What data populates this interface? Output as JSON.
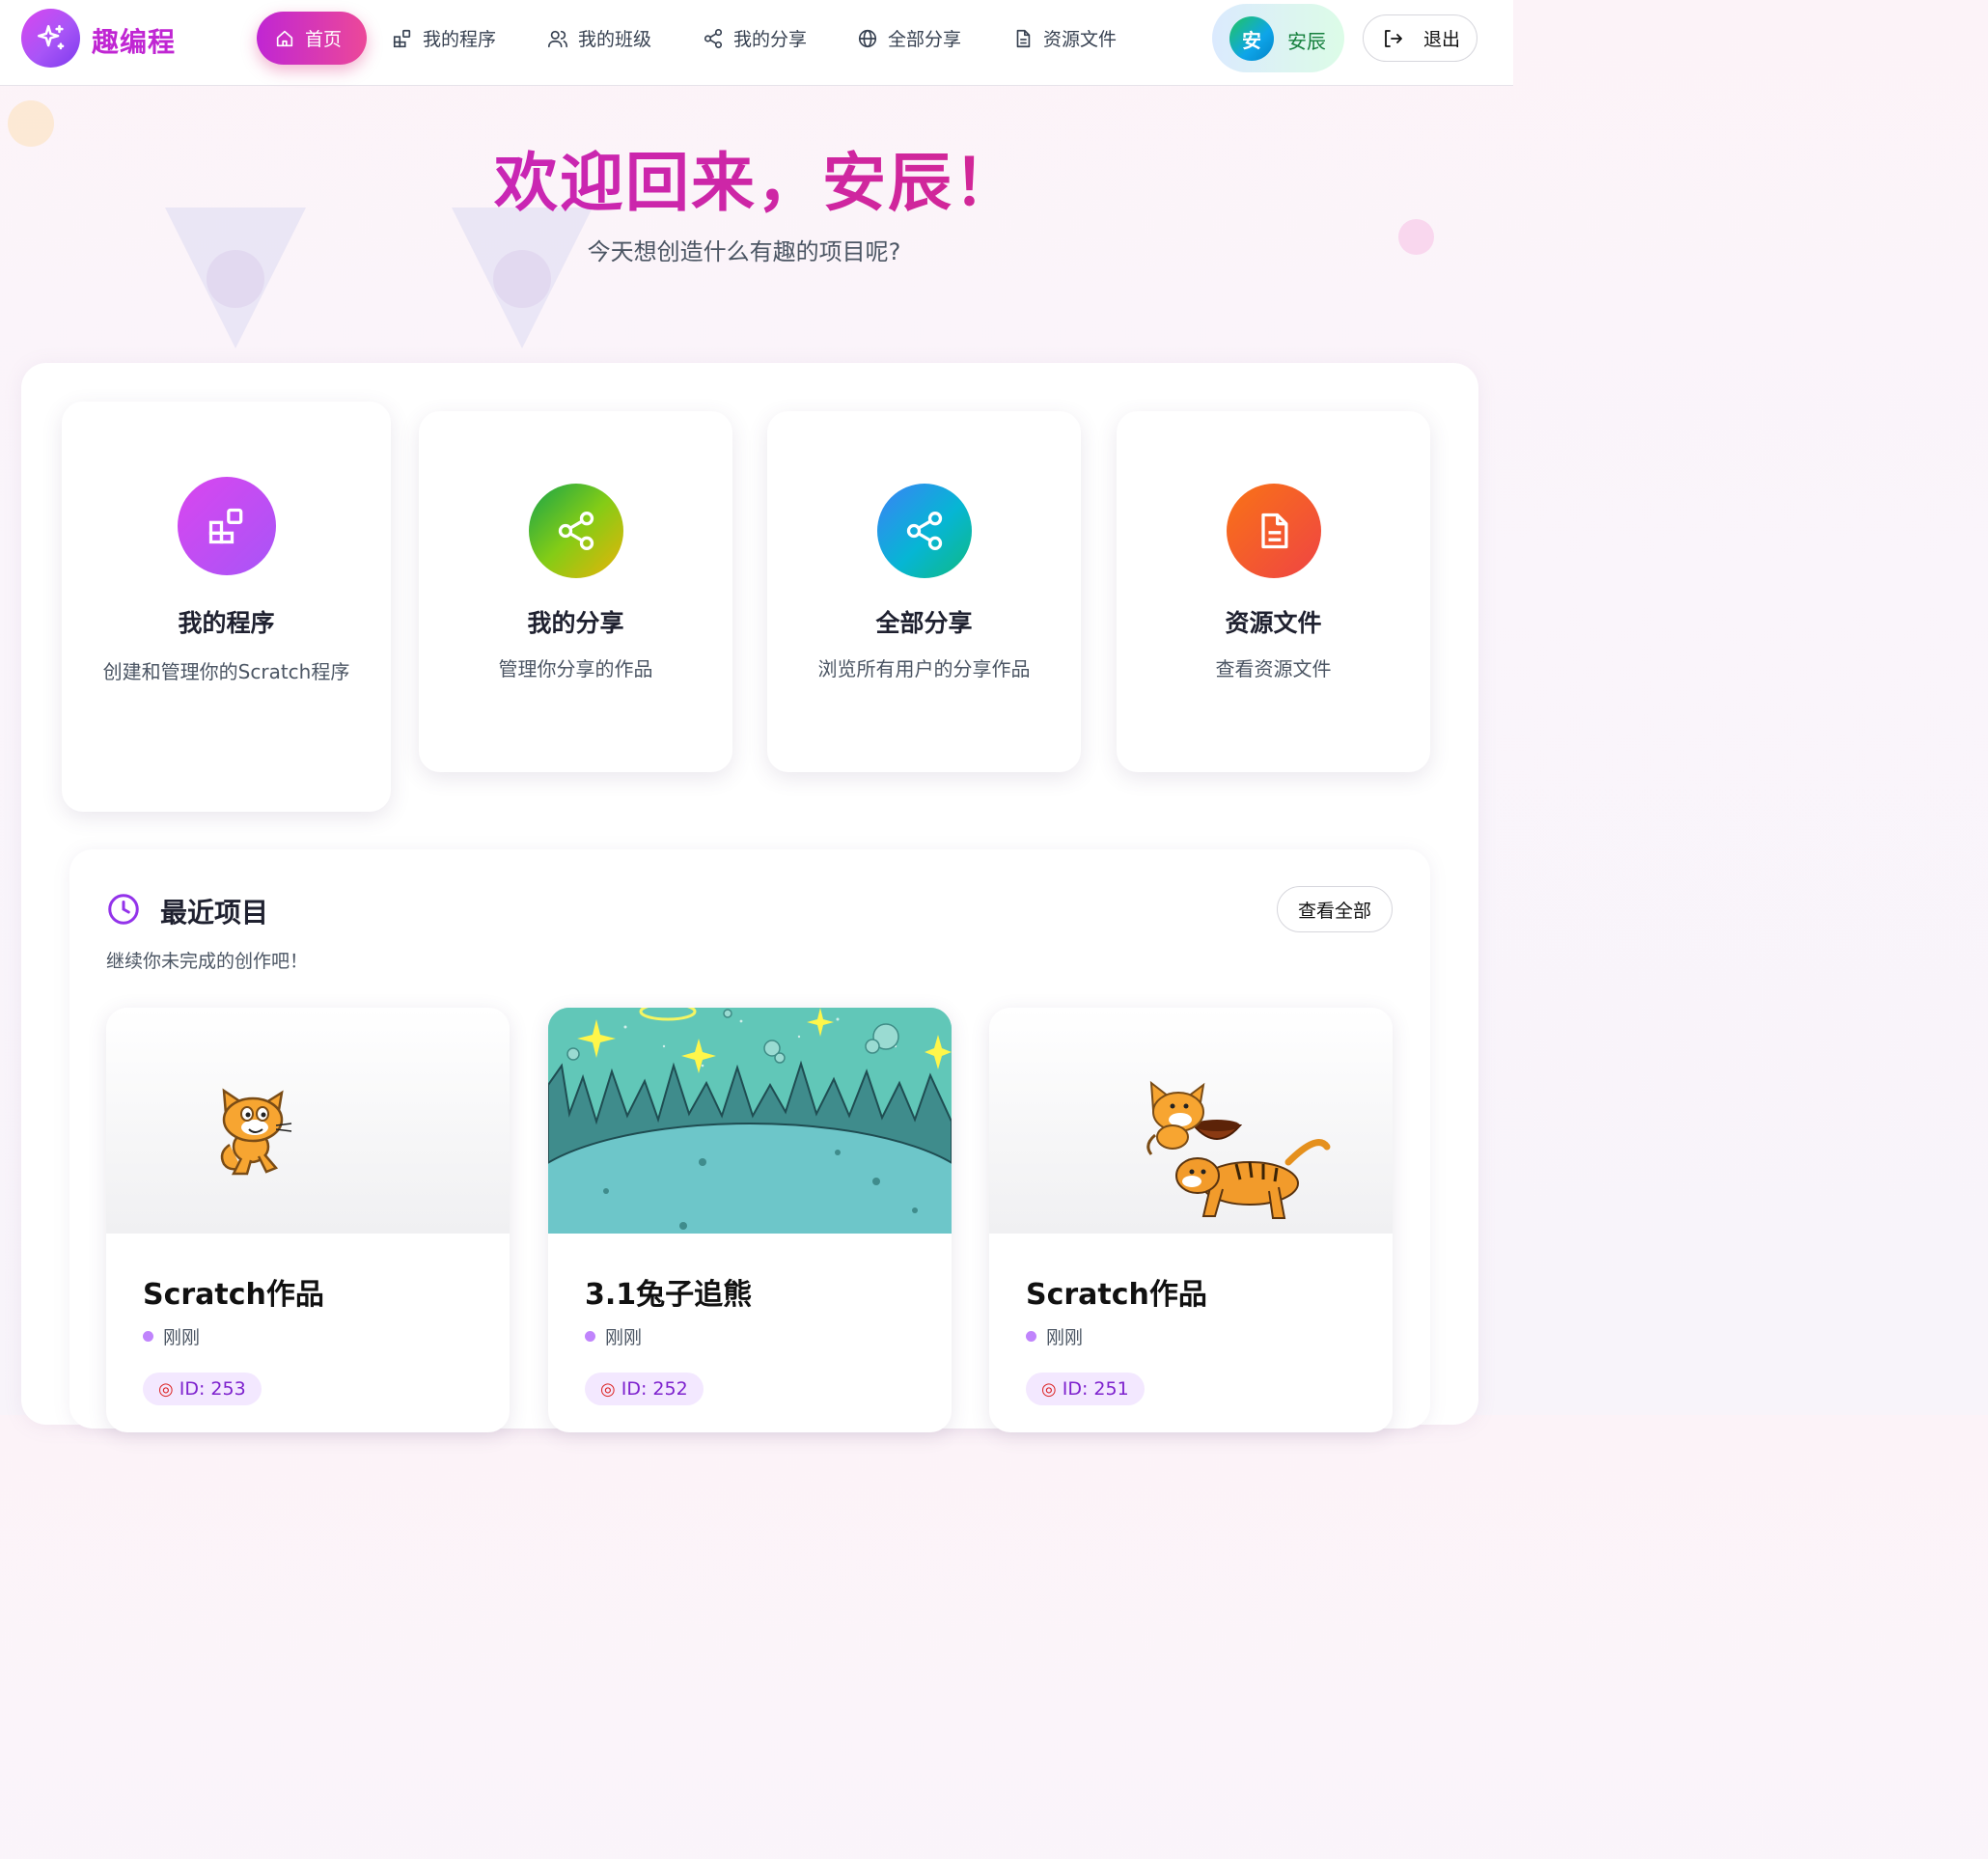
{
  "app": {
    "brand": "趣编程"
  },
  "nav": {
    "items": [
      {
        "label": "首页",
        "icon": "home-icon",
        "active": true
      },
      {
        "label": "我的程序",
        "icon": "blocks-icon"
      },
      {
        "label": "我的班级",
        "icon": "users-icon"
      },
      {
        "label": "我的分享",
        "icon": "share-icon"
      },
      {
        "label": "全部分享",
        "icon": "globe-icon"
      },
      {
        "label": "资源文件",
        "icon": "file-icon"
      }
    ]
  },
  "user": {
    "avatar_char": "安",
    "name": "安辰"
  },
  "logout": {
    "label": "退出"
  },
  "hero": {
    "title": "欢迎回来，安辰！",
    "subtitle": "今天想创造什么有趣的项目呢?"
  },
  "quick_cards": [
    {
      "title": "我的程序",
      "desc": "创建和管理你的Scratch程序",
      "icon": "blocks-icon",
      "gradient": [
        "#d946ef",
        "#a855f7"
      ]
    },
    {
      "title": "我的分享",
      "desc": "管理你分享的作品",
      "icon": "share-icon",
      "gradient": [
        "#22c55e",
        "#eab308"
      ]
    },
    {
      "title": "全部分享",
      "desc": "浏览所有用户的分享作品",
      "icon": "share-icon",
      "gradient": [
        "#3b82f6",
        "#10b981"
      ]
    },
    {
      "title": "资源文件",
      "desc": "查看资源文件",
      "icon": "file-icon",
      "gradient": [
        "#f97316",
        "#ef4444"
      ]
    }
  ],
  "recent": {
    "title": "最近项目",
    "subtitle": "继续你未完成的创作吧！",
    "view_all": "查看全部",
    "projects": [
      {
        "title": "Scratch作品",
        "time": "刚刚",
        "id": "ID: 253",
        "thumb": "scratch-cat"
      },
      {
        "title": "3.1兔子追熊",
        "time": "刚刚",
        "id": "ID: 252",
        "thumb": "space-scene"
      },
      {
        "title": "Scratch作品",
        "time": "刚刚",
        "id": "ID: 251",
        "thumb": "cat-and-tiger"
      }
    ]
  },
  "colors": {
    "accent": "#c026d3",
    "accent_pink": "#db2777",
    "purple_badge_bg": "#f3e8ff"
  }
}
